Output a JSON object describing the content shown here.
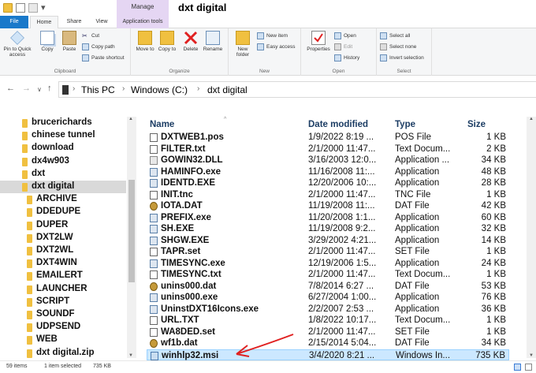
{
  "window": {
    "title": "dxt digital"
  },
  "context_tab": {
    "group": "Manage",
    "tab": "Application tools"
  },
  "tabs": {
    "file": "File",
    "home": "Home",
    "share": "Share",
    "view": "View"
  },
  "ribbon": {
    "clipboard": {
      "label": "Clipboard",
      "pin": "Pin to Quick access",
      "copy": "Copy",
      "paste": "Paste",
      "cut": "Cut",
      "copy_path": "Copy path",
      "paste_shortcut": "Paste shortcut"
    },
    "organize": {
      "label": "Organize",
      "move_to": "Move to",
      "copy_to": "Copy to",
      "delete": "Delete",
      "rename": "Rename"
    },
    "new": {
      "label": "New",
      "new_folder": "New folder",
      "new_item": "New item",
      "easy_access": "Easy access"
    },
    "open": {
      "label": "Open",
      "properties": "Properties",
      "open": "Open",
      "edit": "Edit",
      "history": "History"
    },
    "select": {
      "label": "Select",
      "select_all": "Select all",
      "select_none": "Select none",
      "invert": "Invert selection"
    }
  },
  "breadcrumb": [
    "This PC",
    "Windows (C:)",
    "dxt digital"
  ],
  "nav_items": [
    {
      "label": "brucerichards",
      "indent": 0,
      "selected": false
    },
    {
      "label": "chinese tunnel",
      "indent": 0,
      "selected": false
    },
    {
      "label": "download",
      "indent": 0,
      "selected": false
    },
    {
      "label": "dx4w903",
      "indent": 0,
      "selected": false
    },
    {
      "label": "dxt",
      "indent": 0,
      "selected": false
    },
    {
      "label": "dxt digital",
      "indent": 0,
      "selected": true
    },
    {
      "label": "ARCHIVE",
      "indent": 1,
      "selected": false
    },
    {
      "label": "DDEDUPE",
      "indent": 1,
      "selected": false
    },
    {
      "label": "DUPER",
      "indent": 1,
      "selected": false
    },
    {
      "label": "DXT2LW",
      "indent": 1,
      "selected": false
    },
    {
      "label": "DXT2WL",
      "indent": 1,
      "selected": false
    },
    {
      "label": "DXT4WIN",
      "indent": 1,
      "selected": false
    },
    {
      "label": "EMAILERT",
      "indent": 1,
      "selected": false
    },
    {
      "label": "LAUNCHER",
      "indent": 1,
      "selected": false
    },
    {
      "label": "SCRIPT",
      "indent": 1,
      "selected": false
    },
    {
      "label": "SOUNDF",
      "indent": 1,
      "selected": false
    },
    {
      "label": "UDPSEND",
      "indent": 1,
      "selected": false
    },
    {
      "label": "WEB",
      "indent": 1,
      "selected": false
    },
    {
      "label": "dxt digital.zip",
      "indent": 1,
      "selected": false
    }
  ],
  "columns": {
    "name": "Name",
    "date": "Date modified",
    "type": "Type",
    "size": "Size"
  },
  "files": [
    {
      "name": "DXTWEB1.pos",
      "date": "1/9/2022 8:19 ...",
      "type": "POS File",
      "size": "1 KB",
      "icon": "doc",
      "selected": false
    },
    {
      "name": "FILTER.txt",
      "date": "2/1/2000 11:47...",
      "type": "Text Docum...",
      "size": "2 KB",
      "icon": "doc",
      "selected": false
    },
    {
      "name": "GOWIN32.DLL",
      "date": "3/16/2003 12:0...",
      "type": "Application ...",
      "size": "34 KB",
      "icon": "dll",
      "selected": false
    },
    {
      "name": "HAMINFO.exe",
      "date": "11/16/2008 11:...",
      "type": "Application",
      "size": "48 KB",
      "icon": "exe",
      "selected": false
    },
    {
      "name": "IDENTD.EXE",
      "date": "12/20/2006 10:...",
      "type": "Application",
      "size": "28 KB",
      "icon": "exe",
      "selected": false
    },
    {
      "name": "INIT.tnc",
      "date": "2/1/2000 11:47...",
      "type": "TNC File",
      "size": "1 KB",
      "icon": "doc",
      "selected": false
    },
    {
      "name": "IOTA.DAT",
      "date": "11/19/2008 11:...",
      "type": "DAT File",
      "size": "42 KB",
      "icon": "dat",
      "selected": false
    },
    {
      "name": "PREFIX.exe",
      "date": "11/20/2008 1:1...",
      "type": "Application",
      "size": "60 KB",
      "icon": "exe",
      "selected": false
    },
    {
      "name": "SH.EXE",
      "date": "11/19/2008 9:2...",
      "type": "Application",
      "size": "32 KB",
      "icon": "exe",
      "selected": false
    },
    {
      "name": "SHGW.EXE",
      "date": "3/29/2002 4:21...",
      "type": "Application",
      "size": "14 KB",
      "icon": "exe",
      "selected": false
    },
    {
      "name": "TAPR.set",
      "date": "2/1/2000 11:47...",
      "type": "SET File",
      "size": "1 KB",
      "icon": "doc",
      "selected": false
    },
    {
      "name": "TIMESYNC.exe",
      "date": "12/19/2006 1:5...",
      "type": "Application",
      "size": "24 KB",
      "icon": "exe",
      "selected": false
    },
    {
      "name": "TIMESYNC.txt",
      "date": "2/1/2000 11:47...",
      "type": "Text Docum...",
      "size": "1 KB",
      "icon": "doc",
      "selected": false
    },
    {
      "name": "unins000.dat",
      "date": "7/8/2014 6:27 ...",
      "type": "DAT File",
      "size": "53 KB",
      "icon": "dat",
      "selected": false
    },
    {
      "name": "unins000.exe",
      "date": "6/27/2004 1:00...",
      "type": "Application",
      "size": "76 KB",
      "icon": "exe",
      "selected": false
    },
    {
      "name": "UninstDXT16Icons.exe",
      "date": "2/2/2007 2:53 ...",
      "type": "Application",
      "size": "36 KB",
      "icon": "exe",
      "selected": false
    },
    {
      "name": "URL.TXT",
      "date": "1/8/2022 10:17...",
      "type": "Text Docum...",
      "size": "1 KB",
      "icon": "doc",
      "selected": false
    },
    {
      "name": "WA8DED.set",
      "date": "2/1/2000 11:47...",
      "type": "SET File",
      "size": "1 KB",
      "icon": "doc",
      "selected": false
    },
    {
      "name": "wf1b.dat",
      "date": "2/15/2014 5:04...",
      "type": "DAT File",
      "size": "34 KB",
      "icon": "dat",
      "selected": false
    },
    {
      "name": "winhlp32.msi",
      "date": "3/4/2020 8:21 ...",
      "type": "Windows In...",
      "size": "735 KB",
      "icon": "msi",
      "selected": true
    }
  ],
  "status": {
    "items": "59 items",
    "selected": "1 item selected",
    "size": "735 KB"
  },
  "colors": {
    "accent": "#1979ca",
    "context": "#e5d6f3",
    "selection": "#cce8ff",
    "arrow": "#e02020",
    "header_text": "#1c3d64"
  }
}
